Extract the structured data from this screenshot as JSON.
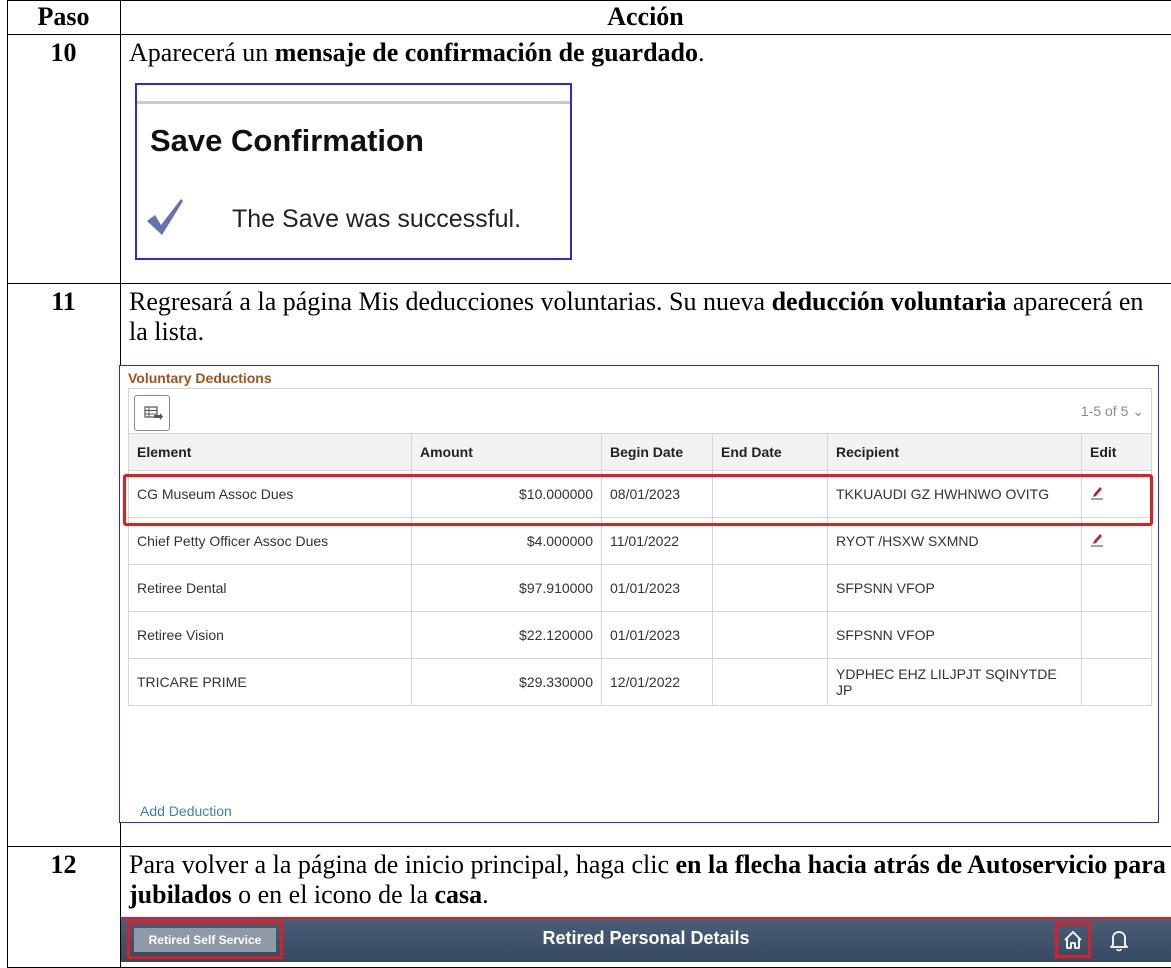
{
  "table": {
    "header_step": "Paso",
    "header_action": "Acción"
  },
  "steps": [
    {
      "num": "10",
      "text_plain_1": "Aparecerá un ",
      "text_bold_1": "mensaje de confirmación de guardado",
      "text_plain_2": "."
    },
    {
      "num": "11",
      "text_plain_1": "Regresará a la página Mis deducciones voluntarias.  Su nueva ",
      "text_bold_1": "deducción voluntaria",
      "text_plain_2": " aparecerá en la lista."
    },
    {
      "num": "12",
      "text_plain_1": "Para volver a la página de inicio principal, haga clic ",
      "text_bold_1": "en la flecha hacia atrás de Autoservicio para jubilados",
      "text_plain_2": " o en el icono de la ",
      "text_bold_2": "casa",
      "text_plain_3": "."
    }
  ],
  "save_confirmation": {
    "title": "Save Confirmation",
    "message": "The Save was successful.",
    "icon": "checkmark-icon"
  },
  "voluntary_deductions": {
    "title": "Voluntary Deductions",
    "pagination": "1-5 of 5",
    "columns": [
      "Element",
      "Amount",
      "Begin Date",
      "End Date",
      "Recipient",
      "Edit"
    ],
    "rows": [
      {
        "element": "CG Museum Assoc Dues",
        "amount": "$10.000000",
        "begin": "08/01/2023",
        "end": "",
        "recipient": "TKKUAUDI GZ HWHNWO OVITG",
        "editable": true
      },
      {
        "element": "Chief Petty Officer Assoc Dues",
        "amount": "$4.000000",
        "begin": "11/01/2022",
        "end": "",
        "recipient": "RYOT /HSXW SXMND",
        "editable": true
      },
      {
        "element": "Retiree Dental",
        "amount": "$97.910000",
        "begin": "01/01/2023",
        "end": "",
        "recipient": "SFPSNN VFOP",
        "editable": false
      },
      {
        "element": "Retiree Vision",
        "amount": "$22.120000",
        "begin": "01/01/2023",
        "end": "",
        "recipient": "SFPSNN VFOP",
        "editable": false
      },
      {
        "element": "TRICARE PRIME",
        "amount": "$29.330000",
        "begin": "12/01/2022",
        "end": "",
        "recipient": "YDPHEC EHZ LILJPJT SQINYTDE JP",
        "editable": false
      }
    ],
    "add_link": "Add Deduction",
    "highlight_color": "#e31b23"
  },
  "header_bar": {
    "back_label": "Retired Self Service",
    "title": "Retired Personal Details",
    "icons": [
      "home-icon",
      "bell-icon"
    ]
  }
}
